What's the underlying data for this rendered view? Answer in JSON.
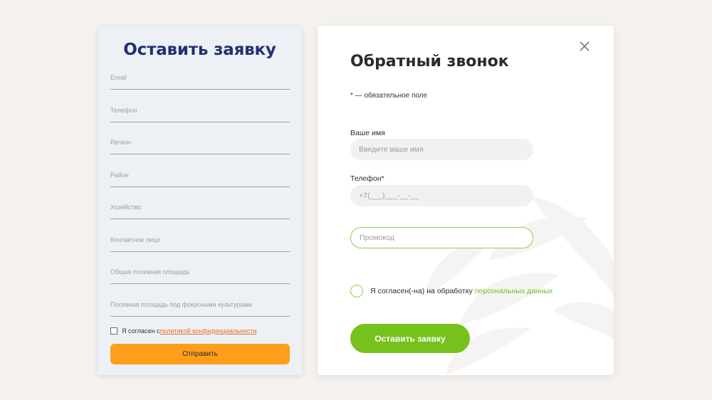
{
  "left_form": {
    "title": "Оставить заявку",
    "fields": [
      {
        "label": "Email"
      },
      {
        "label": "Телефон"
      },
      {
        "label": "Регион"
      },
      {
        "label": "Район"
      },
      {
        "label": "Хозяйство"
      },
      {
        "label": "Контактное лицо"
      },
      {
        "label": "Общая посевная площадь"
      },
      {
        "label": "Посевная площадь под фокусными культурами"
      }
    ],
    "consent_text": "Я согласен с",
    "consent_link": "политикой конфиденциальности",
    "submit_label": "Отправить",
    "accent_color": "#ff9e1b"
  },
  "modal": {
    "title": "Обратный звонок",
    "required_note": "* — обязательное поле",
    "name_label": "Ваше имя",
    "name_placeholder": "Введите ваше имя",
    "phone_label": "Телефон*",
    "phone_placeholder": "+7(___)___-__-__",
    "promo_placeholder": "Промокод",
    "consent_text": "Я согласен(-на) на обработку",
    "consent_link": "персональных данных",
    "submit_label": "Оставить заявку",
    "close_icon": "close-icon",
    "accent_color": "#76c11c"
  }
}
